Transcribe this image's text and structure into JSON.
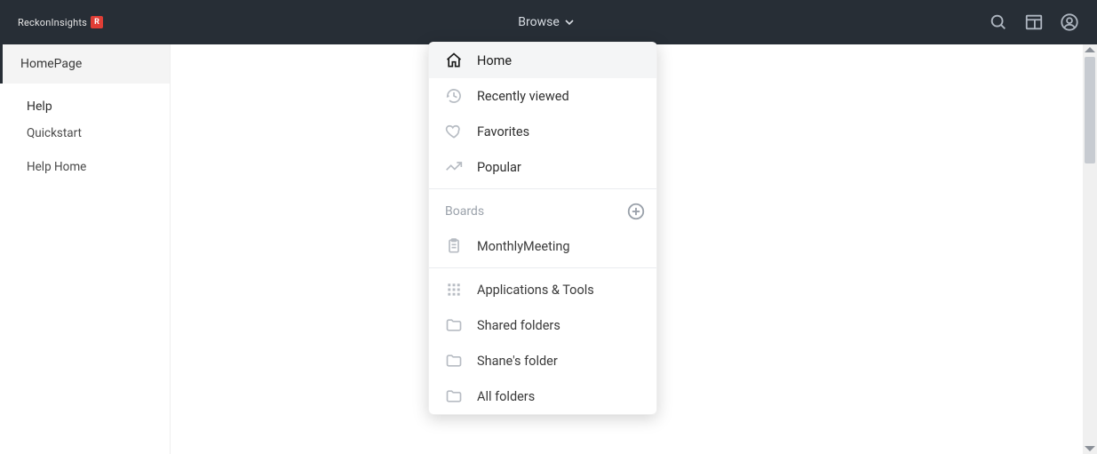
{
  "header": {
    "logo_text": "ReckonInsights",
    "logo_badge": "R",
    "browse_label": "Browse"
  },
  "sidebar": {
    "active_item": "HomePage",
    "section_title": "Help",
    "links": [
      {
        "label": "Quickstart"
      },
      {
        "label": "Help Home"
      }
    ]
  },
  "dropdown": {
    "nav": [
      {
        "label": "Home",
        "icon": "home-icon",
        "active": true
      },
      {
        "label": "Recently viewed",
        "icon": "history-icon",
        "active": false
      },
      {
        "label": "Favorites",
        "icon": "heart-icon",
        "active": false
      },
      {
        "label": "Popular",
        "icon": "trending-icon",
        "active": false
      }
    ],
    "boards_title": "Boards",
    "boards": [
      {
        "label": "MonthlyMeeting",
        "icon": "clipboard-icon"
      }
    ],
    "folders": [
      {
        "label": "Applications & Tools",
        "icon": "apps-icon"
      },
      {
        "label": "Shared folders",
        "icon": "folder-icon"
      },
      {
        "label": "Shane's folder",
        "icon": "folder-icon"
      },
      {
        "label": "All folders",
        "icon": "folder-icon"
      }
    ]
  }
}
